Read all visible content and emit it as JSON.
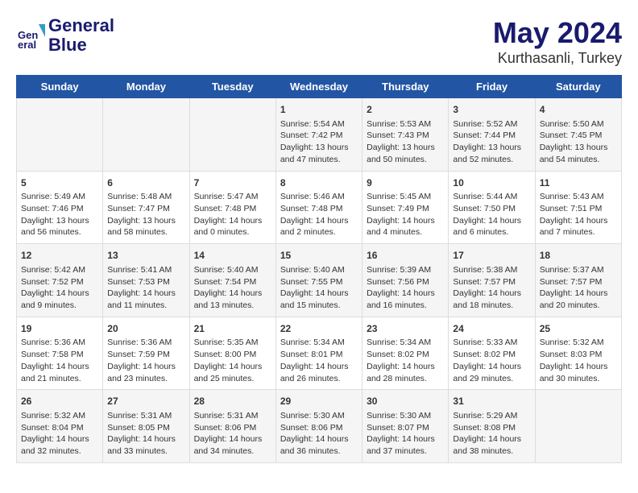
{
  "header": {
    "logo_line1": "General",
    "logo_line2": "Blue",
    "main_title": "May 2024",
    "subtitle": "Kurthasanli, Turkey"
  },
  "days_of_week": [
    "Sunday",
    "Monday",
    "Tuesday",
    "Wednesday",
    "Thursday",
    "Friday",
    "Saturday"
  ],
  "weeks": [
    {
      "days": [
        {
          "num": "",
          "lines": []
        },
        {
          "num": "",
          "lines": []
        },
        {
          "num": "",
          "lines": []
        },
        {
          "num": "1",
          "lines": [
            "Sunrise: 5:54 AM",
            "Sunset: 7:42 PM",
            "Daylight: 13 hours",
            "and 47 minutes."
          ]
        },
        {
          "num": "2",
          "lines": [
            "Sunrise: 5:53 AM",
            "Sunset: 7:43 PM",
            "Daylight: 13 hours",
            "and 50 minutes."
          ]
        },
        {
          "num": "3",
          "lines": [
            "Sunrise: 5:52 AM",
            "Sunset: 7:44 PM",
            "Daylight: 13 hours",
            "and 52 minutes."
          ]
        },
        {
          "num": "4",
          "lines": [
            "Sunrise: 5:50 AM",
            "Sunset: 7:45 PM",
            "Daylight: 13 hours",
            "and 54 minutes."
          ]
        }
      ]
    },
    {
      "days": [
        {
          "num": "5",
          "lines": [
            "Sunrise: 5:49 AM",
            "Sunset: 7:46 PM",
            "Daylight: 13 hours",
            "and 56 minutes."
          ]
        },
        {
          "num": "6",
          "lines": [
            "Sunrise: 5:48 AM",
            "Sunset: 7:47 PM",
            "Daylight: 13 hours",
            "and 58 minutes."
          ]
        },
        {
          "num": "7",
          "lines": [
            "Sunrise: 5:47 AM",
            "Sunset: 7:48 PM",
            "Daylight: 14 hours",
            "and 0 minutes."
          ]
        },
        {
          "num": "8",
          "lines": [
            "Sunrise: 5:46 AM",
            "Sunset: 7:48 PM",
            "Daylight: 14 hours",
            "and 2 minutes."
          ]
        },
        {
          "num": "9",
          "lines": [
            "Sunrise: 5:45 AM",
            "Sunset: 7:49 PM",
            "Daylight: 14 hours",
            "and 4 minutes."
          ]
        },
        {
          "num": "10",
          "lines": [
            "Sunrise: 5:44 AM",
            "Sunset: 7:50 PM",
            "Daylight: 14 hours",
            "and 6 minutes."
          ]
        },
        {
          "num": "11",
          "lines": [
            "Sunrise: 5:43 AM",
            "Sunset: 7:51 PM",
            "Daylight: 14 hours",
            "and 7 minutes."
          ]
        }
      ]
    },
    {
      "days": [
        {
          "num": "12",
          "lines": [
            "Sunrise: 5:42 AM",
            "Sunset: 7:52 PM",
            "Daylight: 14 hours",
            "and 9 minutes."
          ]
        },
        {
          "num": "13",
          "lines": [
            "Sunrise: 5:41 AM",
            "Sunset: 7:53 PM",
            "Daylight: 14 hours",
            "and 11 minutes."
          ]
        },
        {
          "num": "14",
          "lines": [
            "Sunrise: 5:40 AM",
            "Sunset: 7:54 PM",
            "Daylight: 14 hours",
            "and 13 minutes."
          ]
        },
        {
          "num": "15",
          "lines": [
            "Sunrise: 5:40 AM",
            "Sunset: 7:55 PM",
            "Daylight: 14 hours",
            "and 15 minutes."
          ]
        },
        {
          "num": "16",
          "lines": [
            "Sunrise: 5:39 AM",
            "Sunset: 7:56 PM",
            "Daylight: 14 hours",
            "and 16 minutes."
          ]
        },
        {
          "num": "17",
          "lines": [
            "Sunrise: 5:38 AM",
            "Sunset: 7:57 PM",
            "Daylight: 14 hours",
            "and 18 minutes."
          ]
        },
        {
          "num": "18",
          "lines": [
            "Sunrise: 5:37 AM",
            "Sunset: 7:57 PM",
            "Daylight: 14 hours",
            "and 20 minutes."
          ]
        }
      ]
    },
    {
      "days": [
        {
          "num": "19",
          "lines": [
            "Sunrise: 5:36 AM",
            "Sunset: 7:58 PM",
            "Daylight: 14 hours",
            "and 21 minutes."
          ]
        },
        {
          "num": "20",
          "lines": [
            "Sunrise: 5:36 AM",
            "Sunset: 7:59 PM",
            "Daylight: 14 hours",
            "and 23 minutes."
          ]
        },
        {
          "num": "21",
          "lines": [
            "Sunrise: 5:35 AM",
            "Sunset: 8:00 PM",
            "Daylight: 14 hours",
            "and 25 minutes."
          ]
        },
        {
          "num": "22",
          "lines": [
            "Sunrise: 5:34 AM",
            "Sunset: 8:01 PM",
            "Daylight: 14 hours",
            "and 26 minutes."
          ]
        },
        {
          "num": "23",
          "lines": [
            "Sunrise: 5:34 AM",
            "Sunset: 8:02 PM",
            "Daylight: 14 hours",
            "and 28 minutes."
          ]
        },
        {
          "num": "24",
          "lines": [
            "Sunrise: 5:33 AM",
            "Sunset: 8:02 PM",
            "Daylight: 14 hours",
            "and 29 minutes."
          ]
        },
        {
          "num": "25",
          "lines": [
            "Sunrise: 5:32 AM",
            "Sunset: 8:03 PM",
            "Daylight: 14 hours",
            "and 30 minutes."
          ]
        }
      ]
    },
    {
      "days": [
        {
          "num": "26",
          "lines": [
            "Sunrise: 5:32 AM",
            "Sunset: 8:04 PM",
            "Daylight: 14 hours",
            "and 32 minutes."
          ]
        },
        {
          "num": "27",
          "lines": [
            "Sunrise: 5:31 AM",
            "Sunset: 8:05 PM",
            "Daylight: 14 hours",
            "and 33 minutes."
          ]
        },
        {
          "num": "28",
          "lines": [
            "Sunrise: 5:31 AM",
            "Sunset: 8:06 PM",
            "Daylight: 14 hours",
            "and 34 minutes."
          ]
        },
        {
          "num": "29",
          "lines": [
            "Sunrise: 5:30 AM",
            "Sunset: 8:06 PM",
            "Daylight: 14 hours",
            "and 36 minutes."
          ]
        },
        {
          "num": "30",
          "lines": [
            "Sunrise: 5:30 AM",
            "Sunset: 8:07 PM",
            "Daylight: 14 hours",
            "and 37 minutes."
          ]
        },
        {
          "num": "31",
          "lines": [
            "Sunrise: 5:29 AM",
            "Sunset: 8:08 PM",
            "Daylight: 14 hours",
            "and 38 minutes."
          ]
        },
        {
          "num": "",
          "lines": []
        }
      ]
    }
  ]
}
